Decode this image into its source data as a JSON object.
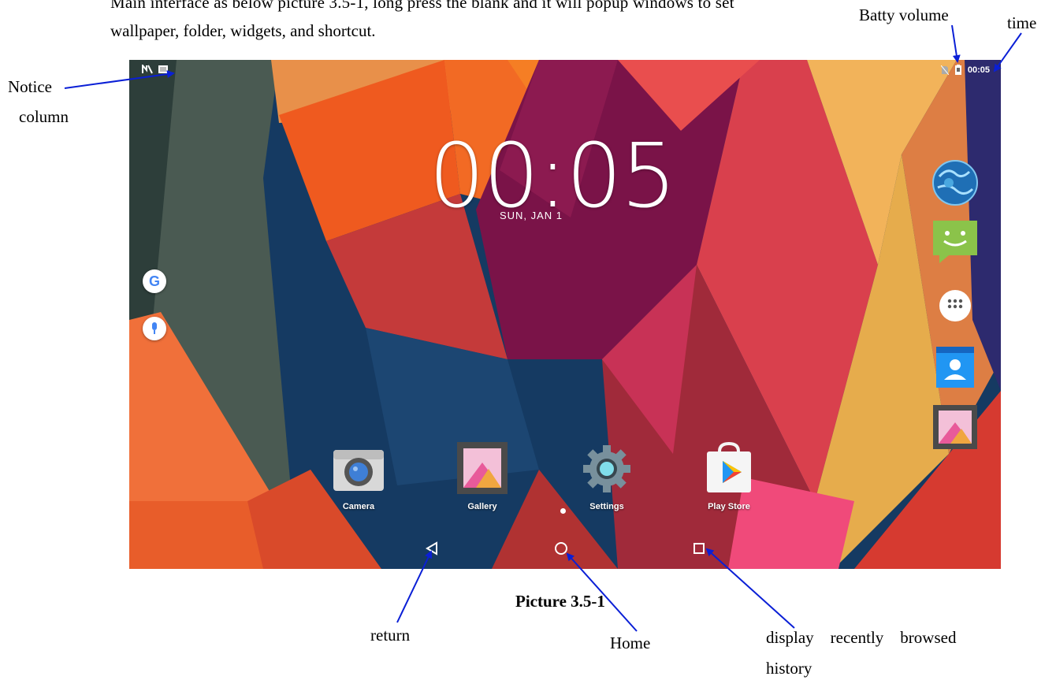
{
  "intro": {
    "line1": "Main interface as below picture 3.5-1, long press the blank and it will popup windows to set",
    "line2": "wallpaper, folder, widgets, and shortcut."
  },
  "annotations": {
    "batty_volume": "Batty volume",
    "time": "time",
    "notice_line1": "Notice",
    "notice_line2": "column",
    "return": "return",
    "home": "Home",
    "recent_line1": "display    recently    browsed",
    "recent_line2": "history"
  },
  "caption": "Picture 3.5-1",
  "screen": {
    "status_time": "00:05",
    "clock": "00:05",
    "date": "SUN, JAN 1",
    "google_letter": "G",
    "dock_apps": [
      {
        "label": "Camera",
        "icon": "camera-icon"
      },
      {
        "label": "Gallery",
        "icon": "gallery-icon"
      },
      {
        "label": "Settings",
        "icon": "settings-gear-icon"
      },
      {
        "label": "Play Store",
        "icon": "play-store-icon"
      }
    ],
    "right_apps": [
      "browser-globe-icon",
      "messaging-icon",
      "app-drawer-icon",
      "contacts-icon",
      "gallery-icon"
    ],
    "nav": [
      "back-triangle-icon",
      "home-circle-icon",
      "recents-square-icon"
    ]
  },
  "colors": {
    "arrow": "#0a1fd6",
    "wallpaper_dark": "#153a62"
  }
}
